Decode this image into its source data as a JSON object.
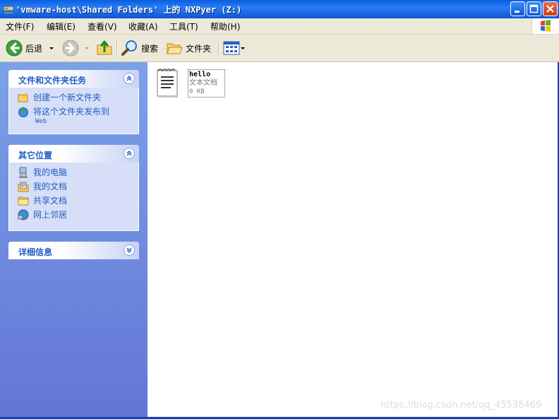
{
  "window": {
    "title": "'vmware-host\\Shared Folders' 上的 NXPyer (Z:)",
    "colors": {
      "titlebar": "#0a5fe0",
      "link": "#215dc6",
      "panel_bg": "#d6dff7",
      "close": "#c6411d"
    }
  },
  "menu": {
    "items": [
      "文件(F)",
      "编辑(E)",
      "查看(V)",
      "收藏(A)",
      "工具(T)",
      "帮助(H)"
    ]
  },
  "toolbar": {
    "back_label": "后退",
    "search_label": "搜索",
    "folders_label": "文件夹",
    "icons": [
      "back-arrow-icon",
      "forward-arrow-icon",
      "up-folder-icon",
      "search-icon",
      "folders-icon",
      "views-icon"
    ]
  },
  "sidebar": {
    "file_tasks": {
      "title": "文件和文件夹任务",
      "items": [
        {
          "label": "创建一个新文件夹",
          "icon": "new-folder-icon"
        },
        {
          "label": "将这个文件夹发布到",
          "sub": "Web",
          "icon": "publish-web-icon"
        }
      ]
    },
    "other_places": {
      "title": "其它位置",
      "items": [
        {
          "label": "我的电脑",
          "icon": "computer-icon"
        },
        {
          "label": "我的文档",
          "icon": "documents-icon"
        },
        {
          "label": "共享文档",
          "icon": "shared-folder-icon"
        },
        {
          "label": "网上邻居",
          "icon": "network-icon"
        }
      ]
    },
    "details": {
      "title": "详细信息"
    }
  },
  "files": [
    {
      "name": "hello",
      "type": "文本文档",
      "size": "0 KB",
      "icon": "text-document-icon"
    }
  ],
  "watermark": "https://blog.csdn.net/qq_45538469"
}
